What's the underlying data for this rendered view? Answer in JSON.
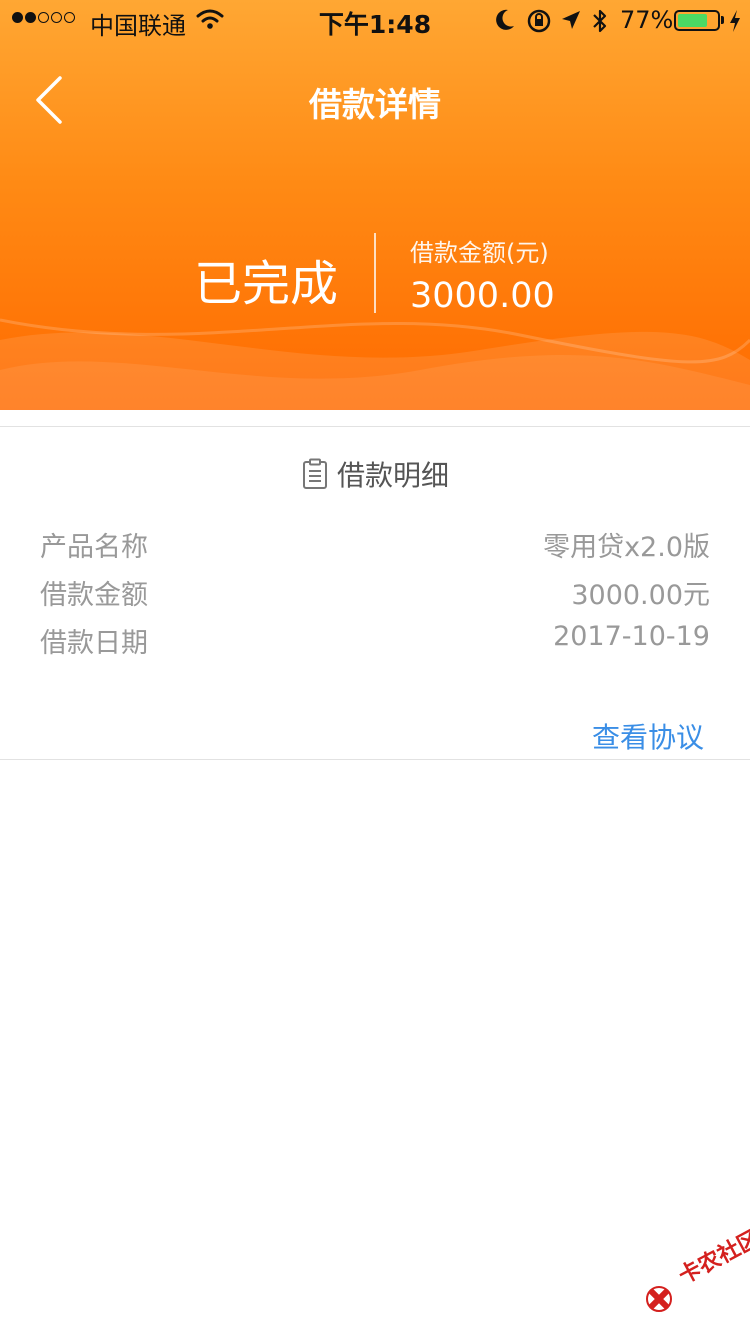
{
  "status_bar": {
    "carrier": "中国联通",
    "time": "下午1:48",
    "battery_percent": "77%",
    "battery_level": 0.77,
    "signal_bars_filled": 2,
    "signal_bars_total": 5
  },
  "nav": {
    "title": "借款详情",
    "back_icon": "chevron-left-icon"
  },
  "summary": {
    "status": "已完成",
    "amount_label": "借款金额(元)",
    "amount_value": "3000.00"
  },
  "details": {
    "section_title": "借款明细",
    "section_icon": "document-icon",
    "rows": [
      {
        "label": "产品名称",
        "value": "零用贷x2.0版"
      },
      {
        "label": "借款金额",
        "value": "3000.00元"
      },
      {
        "label": "借款日期",
        "value": "2017-10-19"
      }
    ],
    "view_agreement": "查看协议"
  },
  "watermark": {
    "text": "卡农社区"
  },
  "colors": {
    "header_gradient_top": "#ffa733",
    "header_gradient_bottom": "#ff6a00",
    "link": "#3a8ee6",
    "muted_text": "#999999",
    "watermark": "#d4201e"
  }
}
